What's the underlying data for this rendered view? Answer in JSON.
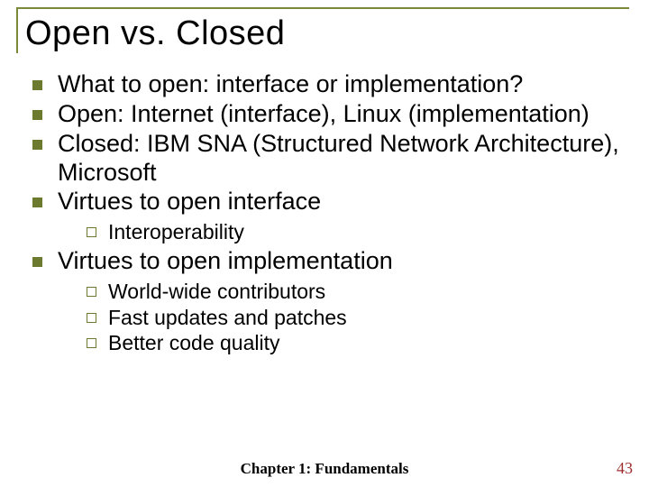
{
  "title": "Open vs. Closed",
  "bullets": {
    "b0": "What to open: interface or implementation?",
    "b1": "Open: Internet (interface), Linux (implementation)",
    "b2": "Closed: IBM SNA (Structured Network Architecture), Microsoft",
    "b3": "Virtues to open interface",
    "b3_sub": {
      "s0": "Interoperability"
    },
    "b4": "Virtues to open implementation",
    "b4_sub": {
      "s0": "World-wide contributors",
      "s1": "Fast updates and patches",
      "s2": "Better code quality"
    }
  },
  "footer": "Chapter 1: Fundamentals",
  "page_number": "43"
}
